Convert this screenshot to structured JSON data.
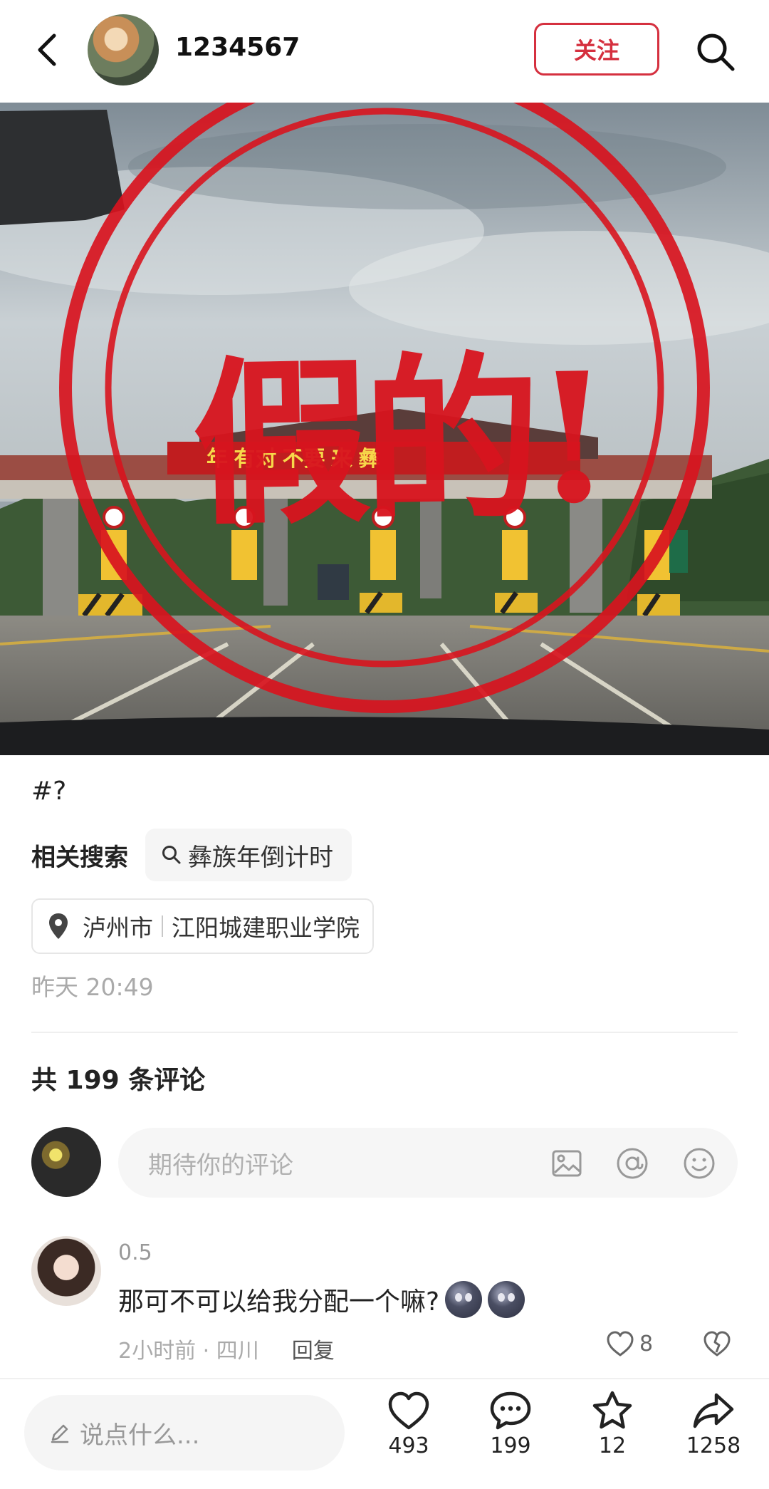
{
  "header": {
    "username": "1234567",
    "follow_label": "关注"
  },
  "media": {
    "stamp_text": "假的!",
    "banner_text": "年 有对 不要 来 彝"
  },
  "post": {
    "hashtag": "#?",
    "related_label": "相关搜索",
    "related_query": "彝族年倒计时",
    "location_city": "泸州市",
    "location_place": "江阳城建职业学院",
    "timestamp": "昨天 20:49",
    "comment_count_label": "共 199 条评论"
  },
  "comment_input": {
    "placeholder": "期待你的评论"
  },
  "comments": [
    {
      "name": "0.5",
      "text": "那可不可以给我分配一个嘛?",
      "meta": "2小时前 · 四川",
      "reply_label": "回复",
      "likes": "8"
    }
  ],
  "bottom_bar": {
    "say_placeholder": "说点什么...",
    "likes": "493",
    "comments": "199",
    "favorites": "12",
    "shares": "1258"
  },
  "colors": {
    "accent": "#d5303f",
    "stamp": "#d8141e"
  }
}
